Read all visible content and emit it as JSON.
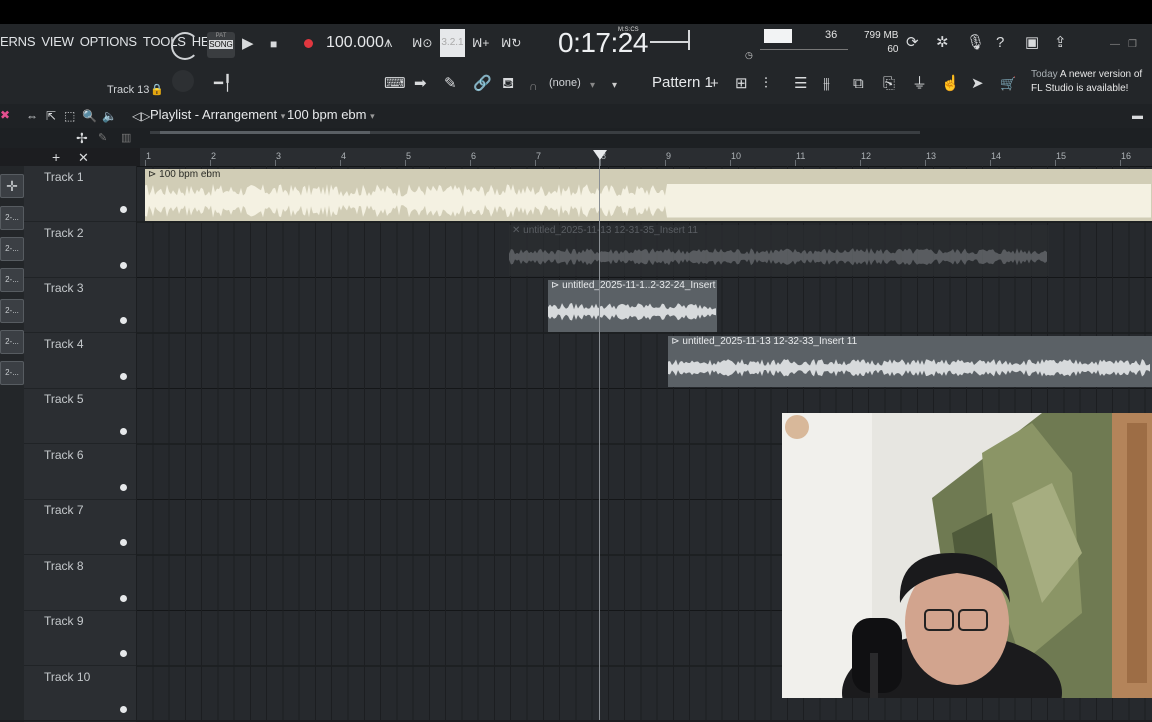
{
  "menu": {
    "items": [
      "ERNS",
      "VIEW",
      "OPTIONS",
      "TOOLS",
      "HELP"
    ]
  },
  "transport": {
    "song_mode_top": "PAT",
    "song_mode_bottom": "SONG",
    "tempo": "100.000",
    "time": "0:17:24",
    "time_format": "M:S:CS"
  },
  "monitor": {
    "cpu": "36",
    "memory": "799 MB",
    "polyphony": "60"
  },
  "toolbar": {
    "pattern": "Pattern 1",
    "channel_none": "(none)",
    "track_label": "Track 13",
    "news_day": "Today",
    "news_text": "A newer version of FL Studio is available!"
  },
  "playlist": {
    "title": "Playlist - Arrangement",
    "arrow": "▾",
    "pattern_name": "100 bpm ebm"
  },
  "ruler": {
    "bars": [
      "1",
      "2",
      "3",
      "4",
      "5",
      "6",
      "7",
      "8",
      "9",
      "10",
      "11",
      "12",
      "13",
      "14",
      "15",
      "16"
    ]
  },
  "tracks": [
    "Track 1",
    "Track 2",
    "Track 3",
    "Track 4",
    "Track 5",
    "Track 6",
    "Track 7",
    "Track 8",
    "Track 9",
    "Track 10"
  ],
  "left_strip": [
    "2-...",
    "2-...",
    "2-...",
    "2-...",
    "2-...",
    "2-..."
  ],
  "clips": [
    {
      "name": "100 bpm ebm",
      "track": 1,
      "start_bar": 1,
      "end_bar": 17.5,
      "color": "#d1cdb6"
    },
    {
      "name": "untitled_2025-11-13 12-31-35_Insert 11",
      "track": 2,
      "start_bar": 6.6,
      "end_bar": 14.9,
      "color": "#2a2d30",
      "muted": true
    },
    {
      "name": "untitled_2025-11-1..2-32-24_Insert 11",
      "track": 3,
      "start_bar": 7.2,
      "end_bar": 9.8,
      "color": "#5b6166"
    },
    {
      "name": "untitled_2025-11-13 12-32-33_Insert 11",
      "track": 4,
      "start_bar": 9.05,
      "end_bar": 17.5,
      "color": "#5b6166"
    }
  ],
  "playhead_bar": 8.0,
  "colors": {
    "accent": "#e44f8f",
    "background": "#1c1d20"
  }
}
